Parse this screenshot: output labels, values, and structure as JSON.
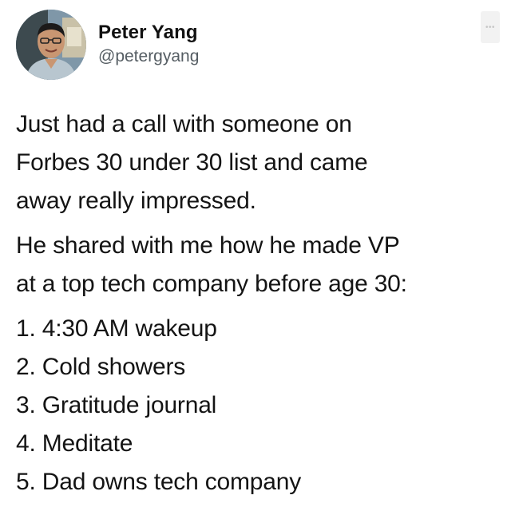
{
  "author": {
    "name": "Peter Yang",
    "handle": "@petergyang",
    "avatar_icon": "profile-photo"
  },
  "menu": {
    "more_label": "•••"
  },
  "tweet": {
    "paragraphs": [
      [
        "Just had a call with someone on",
        "Forbes 30 under 30 list and came",
        "away really impressed."
      ],
      [
        "He shared with me how he made VP",
        "at a top tech company before age 30:"
      ]
    ],
    "list_items": [
      "1. 4:30 AM wakeup",
      "2. Cold showers",
      "3. Gratitude journal",
      "4. Meditate",
      "5. Dad owns tech company"
    ]
  }
}
